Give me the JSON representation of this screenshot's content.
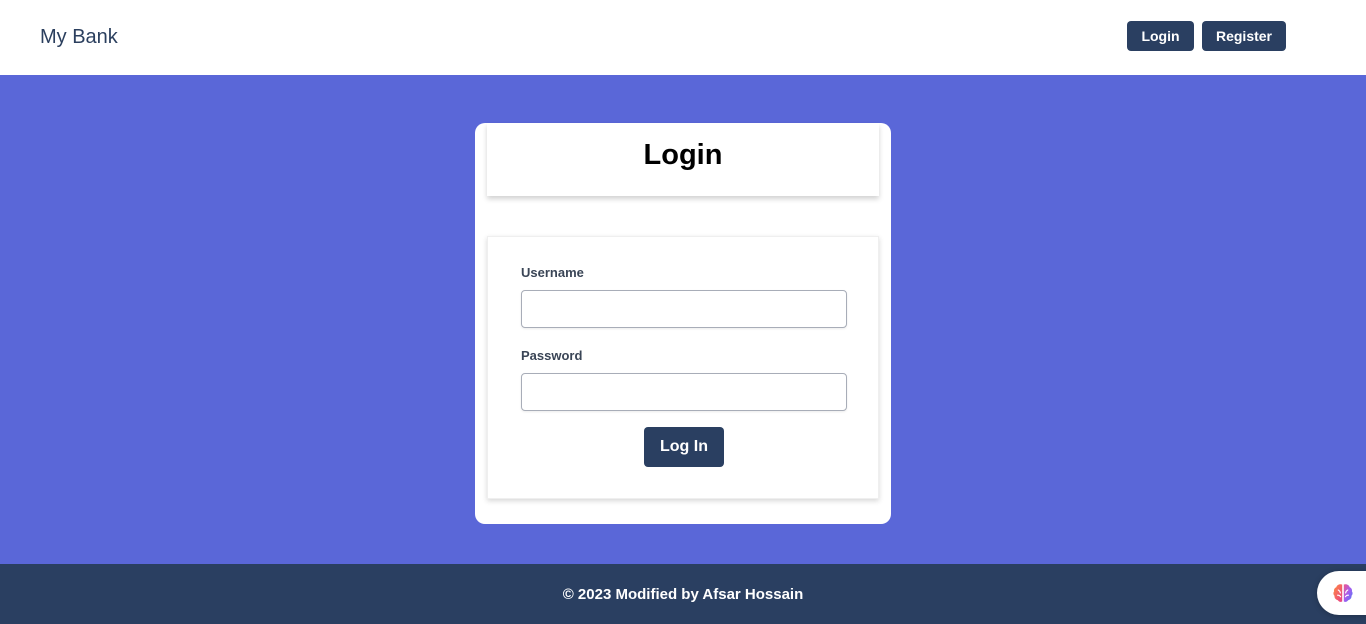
{
  "header": {
    "brand": "My Bank",
    "login_label": "Login",
    "register_label": "Register"
  },
  "login_card": {
    "title": "Login",
    "username_label": "Username",
    "username_value": "",
    "password_label": "Password",
    "password_value": "",
    "submit_label": "Log In"
  },
  "footer": {
    "text": "© 2023 Modified by Afsar Hossain"
  },
  "widget": {
    "icon": "brain-icon"
  },
  "colors": {
    "accent": "#5a67d8",
    "primary_dark": "#2a3f61"
  }
}
